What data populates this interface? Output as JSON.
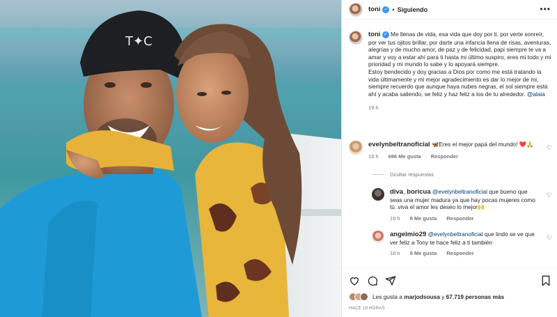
{
  "header": {
    "username": "toni",
    "verified_icon": "verified-badge-icon",
    "separator": "•",
    "follow_label": "Siguiendo",
    "more_icon": "more-options-icon"
  },
  "caption": {
    "username": "toni",
    "text": "Me llenas de vida, esa vida que doy por ti, por verte sonreír, por ver tus ojitos brillar, por darte una infancia llena de risas, aventuras, alegrías y de mucho amor, de paz y de felicidad, papi siempre te va a amar y voy a estar ahí para ti hasta mi último suspiro, eres mi todo y mi prioridad y mi mundo lo sabe y lo apoyará siempre.\nEstoy bendecido y doy gracias a Dios por como me está tratando la vida últimamente y mi mejor agradecimiento es dar lo mejor de mi, siempre recuerdo que aunque haya nubes negras, el sol siempre está ahí y acaba saliendo, se feliz y haz feliz a los de tu alrededor.",
    "mention": "@alaia",
    "time": "19 h"
  },
  "comments": [
    {
      "username": "evelynbeltranoficial",
      "text": "Eres el mejor papá del mundo!",
      "prefix_emoji": "🦋",
      "suffix_emoji": "❤️🙏",
      "time": "19 h",
      "likes": "696 Me gusta",
      "reply_label": "Responder"
    },
    {
      "username": "diva_boricua",
      "mention": "@evelynbeltranoficial",
      "text": "que bueno que seas una mujer madura ya que hay pocas mujeres como tú .viva el amor les deseo lo mejor",
      "suffix_emoji": "🙌",
      "time": "19 h",
      "likes": "8 Me gusta",
      "reply_label": "Responder"
    },
    {
      "username": "angelmio29",
      "mention": "@evelynbeltranoficial",
      "text": "que lindo se ve que ver feliz a Tony te hace feliz a ti también",
      "time": "18 h",
      "likes": "5 Me gusta",
      "reply_label": "Responder"
    }
  ],
  "hide_replies_label": "Ocultar respuestas",
  "footer": {
    "icons": [
      "heart-icon",
      "comment-icon",
      "share-icon",
      "bookmark-icon"
    ],
    "likes_prefix": "Les gusta a",
    "liker": "marjodsousa",
    "likes_and": "y",
    "likes_count": "67.719 personas más",
    "timestamp": "HACE 19 HORAS"
  },
  "colors": {
    "link": "#00376b",
    "verified": "#3897f0",
    "muted": "#737373"
  }
}
